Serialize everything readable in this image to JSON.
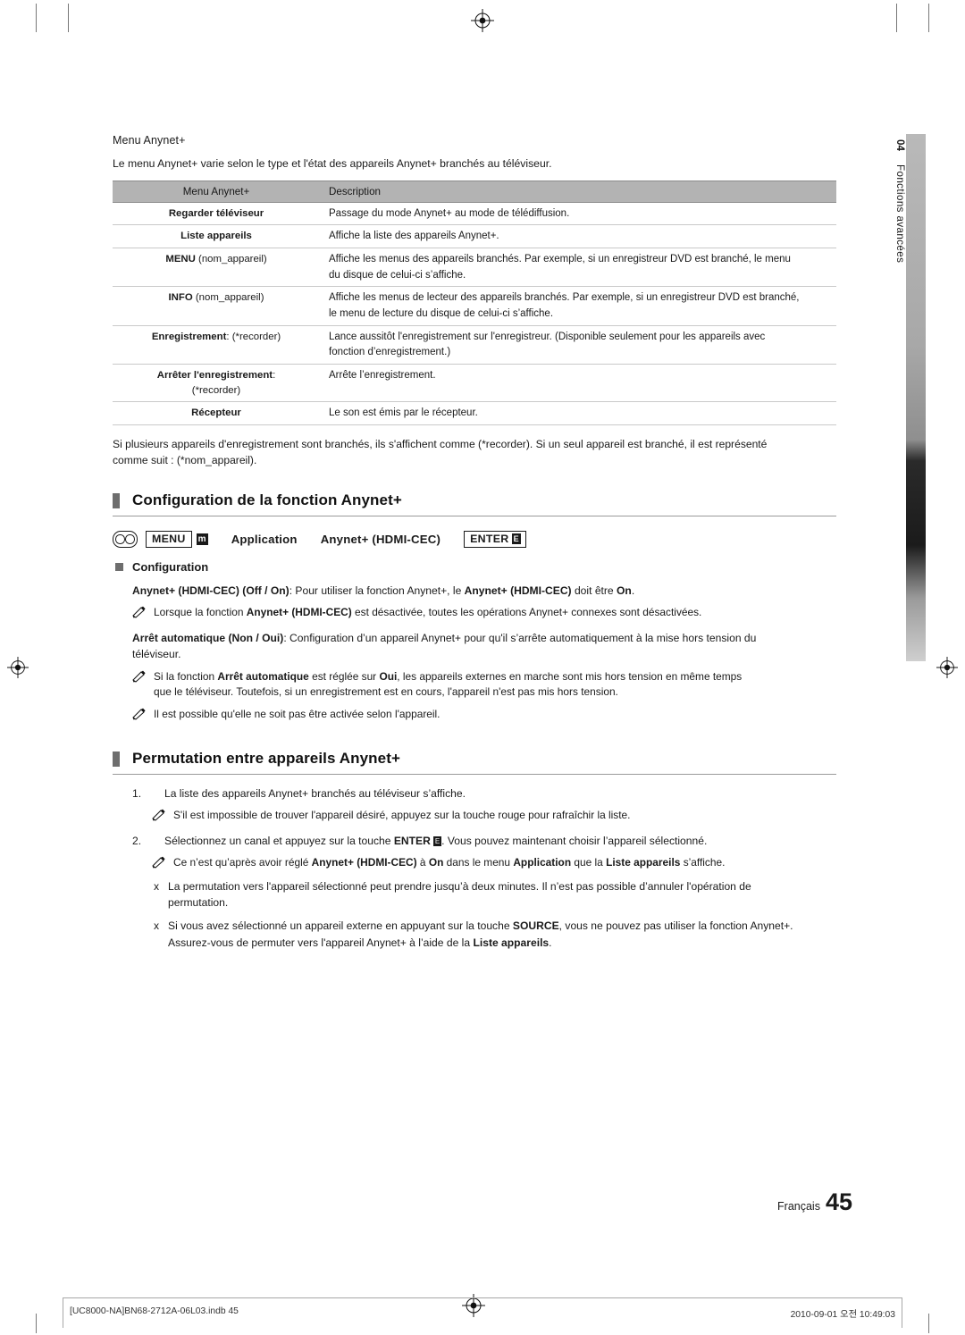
{
  "document": {
    "language_label": "Français",
    "page_number": "45",
    "side_tab": {
      "chapter_number": "04",
      "chapter_title": "Fonctions avancées"
    },
    "footer": {
      "left": "[UC8000-NA]BN68-2712A-06L03.indb   45",
      "right": "2010-09-01   오전 10:49:03"
    }
  },
  "section_menu": {
    "heading": "Menu Anynet+",
    "intro": "Le menu Anynet+ varie selon le type et l'état des appareils Anynet+ branchés au téléviseur.",
    "table": {
      "headers": [
        "Menu Anynet+",
        "Description"
      ],
      "rows": [
        {
          "label": "Regarder téléviseur",
          "label_normal": "",
          "desc": "Passage du mode Anynet+ au mode de télédiffusion.",
          "desc2": ""
        },
        {
          "label": "Liste appareils",
          "label_normal": "",
          "desc": "Affiche la liste des appareils Anynet+.",
          "desc2": ""
        },
        {
          "label": "MENU",
          "label_normal": "(nom_appareil)",
          "desc": "Affiche les menus des appareils branchés. Par exemple, si un enregistreur DVD est branché, le menu",
          "desc2": "du disque de celui-ci s’affiche."
        },
        {
          "label": "INFO",
          "label_normal": "(nom_appareil)",
          "desc": "Affiche les menus de lecteur des appareils branchés. Par exemple, si un enregistreur DVD est branché,",
          "desc2": "le menu de lecture du disque de celui-ci s’affiche."
        },
        {
          "label": "Enregistrement",
          "label_normal": ": (*recorder)",
          "desc": "Lance aussitôt l'enregistrement sur l'enregistreur. (Disponible seulement pour les appareils avec",
          "desc2": "fonction d’enregistrement.)"
        },
        {
          "label": "Arrêter l'enregistrement",
          "label_normal": ":",
          "label_line2": "(*recorder)",
          "desc": "Arrête l’enregistrement.",
          "desc2": ""
        },
        {
          "label": "Récepteur",
          "label_normal": "",
          "desc": "Le son est émis par le récepteur.",
          "desc2": ""
        }
      ]
    },
    "after_table_line1": "Si plusieurs appareils d'enregistrement sont branchés, ils s'affichent comme (*recorder). Si un seul appareil est branché, il est représenté",
    "after_table_line2": "comme suit : (*nom_appareil)."
  },
  "section_config": {
    "heading": "Configuration de la fonction Anynet+",
    "path": {
      "menu_label": "MENU",
      "menu_badge": "m",
      "item1": "Application",
      "item2": "Anynet+ (HDMI-CEC)",
      "enter_label": "ENTER",
      "enter_badge": "E"
    },
    "subhead": "Configuration",
    "para1": {
      "lead": "Anynet+ (HDMI-CEC) (Off / On)",
      "rest": ": Pour utiliser la fonction Anynet+, le ",
      "bold1": "Anynet+ (HDMI-CEC)",
      "rest2": " doit être ",
      "bold2": "On",
      "end": "."
    },
    "note1": {
      "pre": "Lorsque la fonction ",
      "bold": "Anynet+ (HDMI-CEC)",
      "post": " est désactivée, toutes les opérations Anynet+ connexes sont désactivées."
    },
    "para2": {
      "lead": "Arrêt automatique (Non / Oui)",
      "rest": ": Configuration d’un appareil Anynet+ pour qu'il s’arrête automatiquement à la mise hors tension du",
      "line2": "téléviseur."
    },
    "note2": {
      "pre": "Si la fonction ",
      "bold1": "Arrêt automatique",
      "mid": " est réglée sur ",
      "bold2": "Oui",
      "post": ", les appareils externes en marche sont mis hors tension en même temps",
      "line2": "que le téléviseur. Toutefois, si un enregistrement est en cours, l'appareil n'est pas mis hors tension."
    },
    "note3": "Il est possible qu'elle ne soit pas être activée selon l'appareil."
  },
  "section_switch": {
    "heading": "Permutation entre appareils Anynet+",
    "steps": [
      {
        "num": "1.",
        "text": "La liste des appareils Anynet+ branchés au téléviseur s’affiche."
      },
      {
        "num": "2.",
        "text_pre": "Sélectionnez un canal et appuyez sur la touche ",
        "bold": "ENTER",
        "text_post": ". Vous pouvez maintenant choisir l’appareil sélectionné."
      }
    ],
    "note_after_1": "S'il est impossible de trouver l'appareil désiré, appuyez sur la touche rouge pour rafraîchir la liste.",
    "note_after_2": {
      "pre": "Ce n’est qu’après avoir réglé ",
      "bold1": "Anynet+ (HDMI-CEC)",
      "mid1": " à ",
      "bold2": "On",
      "mid2": " dans le menu ",
      "bold3": "Application",
      "mid3": " que la ",
      "bold4": "Liste appareils",
      "post": " s’affiche."
    },
    "bullets": [
      {
        "line1": "La permutation vers l'appareil sélectionné peut prendre jusqu’à deux minutes. Il n’est pas possible d’annuler l'opération de",
        "line2": "permutation."
      },
      {
        "line1_pre": "Si vous avez sélectionné un appareil externe en appuyant sur la touche ",
        "bold": "SOURCE",
        "line1_post": ", vous ne pouvez pas utiliser la fonction Anynet+.",
        "line2_pre": "Assurez-vous de permuter vers l'appareil Anynet+ à l’aide de la ",
        "bold2": "Liste appareils",
        "line2_post": "."
      }
    ]
  },
  "colors": {
    "table_header_bg": "#b3b3b3",
    "rule": "#9a9a9a",
    "marker": "#6e6e6e"
  }
}
